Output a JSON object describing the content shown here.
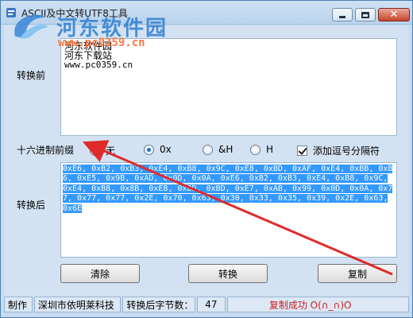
{
  "window": {
    "title": "ASCII及中文转UTF8工具"
  },
  "watermark": {
    "title": "河东软件园",
    "url": "www.pc0359.cn"
  },
  "input": {
    "label": "转换前",
    "lines": [
      "河东软件园",
      "河东下载站",
      "www.pc0359.cn"
    ]
  },
  "prefix": {
    "label": "十六进制前缀",
    "options": [
      {
        "label": "无",
        "checked": false
      },
      {
        "label": "0x",
        "checked": true
      },
      {
        "label": "&H",
        "checked": false
      },
      {
        "label": "H",
        "checked": false
      }
    ],
    "comma": {
      "label": "添加逗号分隔符",
      "checked": true
    }
  },
  "output": {
    "label": "转换后",
    "value": "0xE6, 0xB2, 0xB3, 0xE4, 0xB8, 0x9C, 0xE8, 0xBD, 0xAF, 0xE4, 0xBB, 0xB6, 0xE5, 0x9B, 0xAD, 0x0D, 0x0A, 0xE6, 0xB2, 0xB3, 0xE4, 0xB8, 0x9C, 0xE4, 0xB8, 0x8B, 0xE8, 0xBD, 0xBD, 0xE7, 0xAB, 0x99, 0x0D, 0x0A, 0x77, 0x77, 0x77, 0x2E, 0x70, 0x63, 0x30, 0x33, 0x35, 0x39, 0x2E, 0x63, 0x6E"
  },
  "buttons": {
    "clear": "清除",
    "convert": "转换",
    "copy": "复制"
  },
  "status": {
    "author_label": "制作",
    "author": "深圳市依明莱科技",
    "bytes_label": "转换后字节数：",
    "bytes": "47",
    "message": "复制成功 O(∩_∩)O"
  },
  "colors": {
    "selection": "#3399ff",
    "arrow": "#e02a2a",
    "status_ok": "#d02020"
  }
}
